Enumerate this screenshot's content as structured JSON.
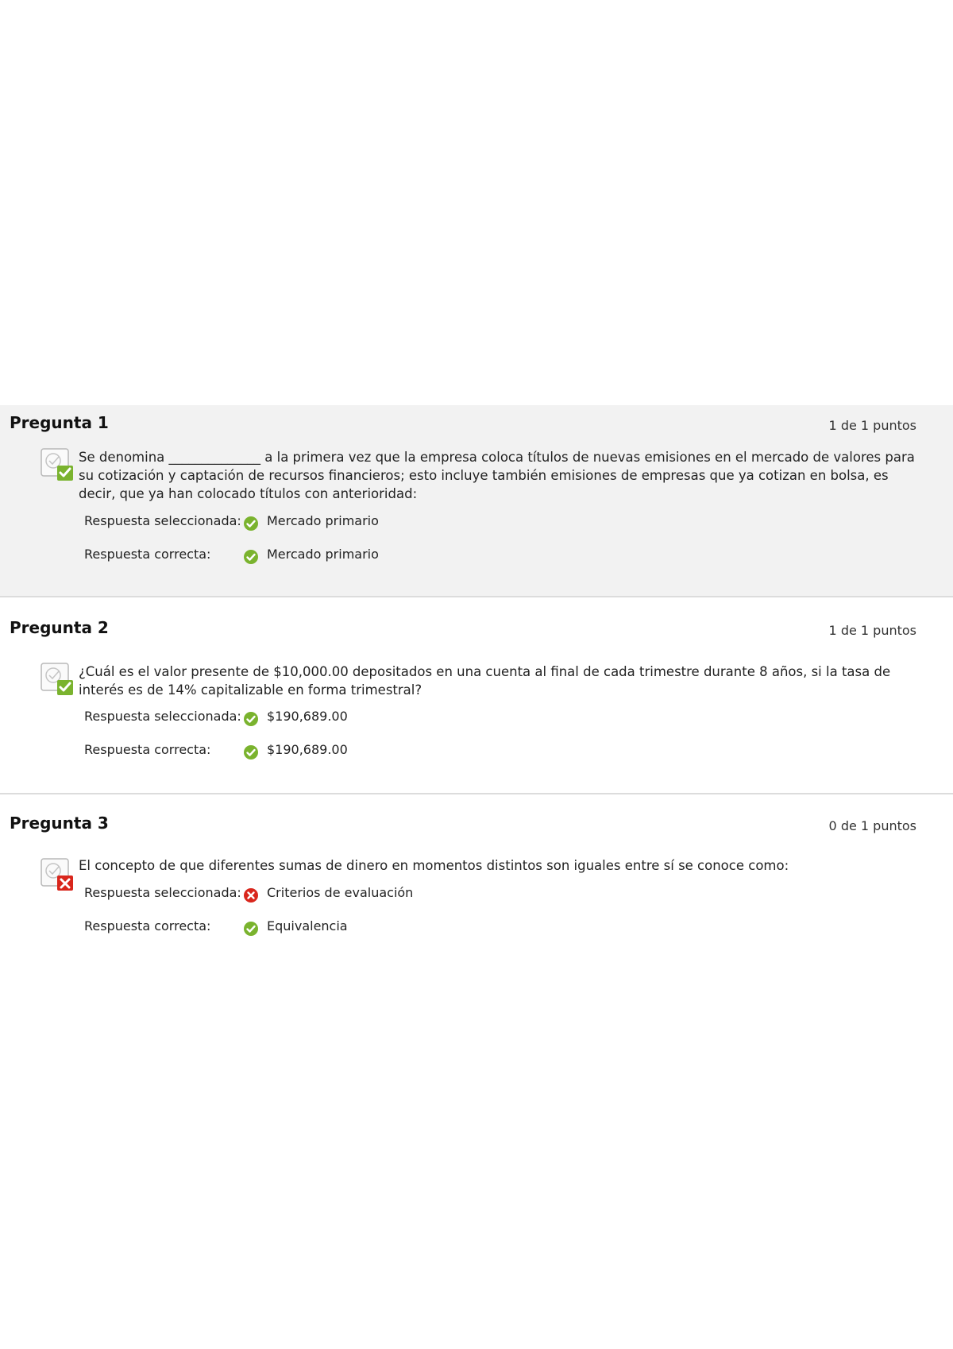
{
  "questions": [
    {
      "title": "Pregunta 1",
      "points": "1 de 1 puntos",
      "status_icon": "correct-question-icon",
      "text": "Se denomina ______________ a la primera vez que la empresa coloca títulos de nuevas emisiones en el mercado de valores para su cotización y captación de recursos financieros; esto incluye también emisiones de empresas que ya cotizan en bolsa, es decir, que ya han colocado títulos con anterioridad:",
      "selected_label": "Respuesta seleccionada:",
      "selected_value": "Mercado primario",
      "selected_icon": "check-circle-icon",
      "correct_label": "Respuesta correcta:",
      "correct_value": "Mercado primario",
      "correct_icon": "check-circle-icon"
    },
    {
      "title": "Pregunta 2",
      "points": "1 de 1 puntos",
      "status_icon": "correct-question-icon",
      "text": "¿Cuál es el valor presente de $10,000.00 depositados en una cuenta al final de cada trimestre durante 8 años, si la tasa de interés es de 14% capitalizable en forma trimestral?",
      "selected_label": "Respuesta seleccionada:",
      "selected_value": "$190,689.00",
      "selected_icon": "check-circle-icon",
      "correct_label": "Respuesta correcta:",
      "correct_value": "$190,689.00",
      "correct_icon": "check-circle-icon"
    },
    {
      "title": "Pregunta 3",
      "points": "0 de 1 puntos",
      "status_icon": "incorrect-question-icon",
      "text": "El concepto de que diferentes sumas de dinero en momentos distintos son iguales entre sí se conoce como:",
      "selected_label": "Respuesta seleccionada:",
      "selected_value": "Criterios de evaluación",
      "selected_icon": "x-circle-icon",
      "correct_label": "Respuesta correcta:",
      "correct_value": "Equivalencia",
      "correct_icon": "check-circle-icon"
    }
  ],
  "colors": {
    "correct": "#7ab32e",
    "incorrect": "#d9261c",
    "shaded_bg": "#f2f2f2",
    "divider": "#dcdcdc"
  }
}
